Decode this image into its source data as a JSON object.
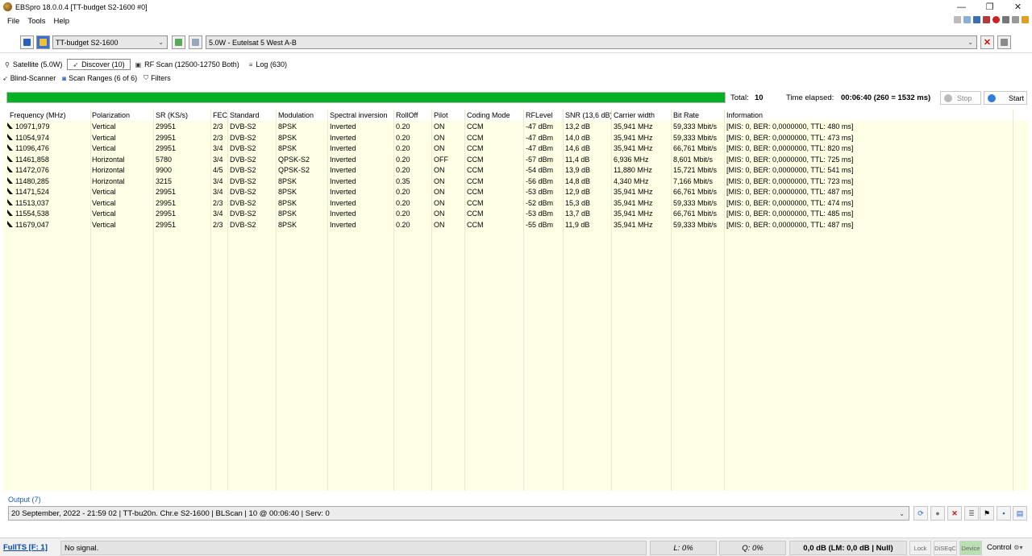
{
  "window": {
    "title": "EBSpro 18.0.0.4 [TT-budget S2-1600 #0]",
    "controls": {
      "minimize": "—",
      "restore": "❐",
      "close": "✕"
    }
  },
  "menu": [
    "File",
    "Tools",
    "Help"
  ],
  "device": {
    "selected": "TT-budget S2-1600",
    "satellite": "5.0W - Eutelsat 5 West A-B"
  },
  "tabs": [
    {
      "label": "Satellite (5.0W)",
      "icon": "satellite-icon"
    },
    {
      "label": "Discover (10)",
      "icon": "discover-icon"
    },
    {
      "label": "RF Scan (12500-12750 Both)",
      "icon": "rf-scan-icon"
    },
    {
      "label": "Log (630)",
      "icon": "log-icon"
    }
  ],
  "subtabs": [
    {
      "label": "Blind-Scanner",
      "icon": "blind-scanner-icon"
    },
    {
      "label": "Scan Ranges (6 of 6)",
      "icon": "scan-ranges-icon"
    },
    {
      "label": "Filters",
      "icon": "filter-icon"
    }
  ],
  "scan": {
    "progress": 1.0,
    "total_label": "Total:",
    "total_value": "10",
    "elapsed_label": "Time elapsed:",
    "elapsed_value": "00:06:40 (260 = 1532 ms)",
    "stop_label": "Stop",
    "start_label": "Start"
  },
  "table": {
    "columns": [
      "Frequency (MHz)",
      "Polarization",
      "SR (KS/s)",
      "FEC",
      "Standard",
      "Modulation",
      "Spectral inversion",
      "RollOff",
      "Pilot",
      "Coding Mode",
      "RFLevel",
      "SNR (13,6 dB)",
      "Carrier width",
      "Bit Rate",
      "Information"
    ],
    "rows": [
      [
        "10971,979",
        "Vertical",
        "29951",
        "2/3",
        "DVB-S2",
        "8PSK",
        "Inverted",
        "0.20",
        "ON",
        "CCM",
        "-47 dBm",
        "13,2 dB",
        "35,941 MHz",
        "59,333 Mbit/s",
        "[MIS: 0, BER: 0,0000000, TTL: 480 ms]"
      ],
      [
        "11054,974",
        "Vertical",
        "29951",
        "2/3",
        "DVB-S2",
        "8PSK",
        "Inverted",
        "0.20",
        "ON",
        "CCM",
        "-47 dBm",
        "14,0 dB",
        "35,941 MHz",
        "59,333 Mbit/s",
        "[MIS: 0, BER: 0,0000000, TTL: 473 ms]"
      ],
      [
        "11096,476",
        "Vertical",
        "29951",
        "3/4",
        "DVB-S2",
        "8PSK",
        "Inverted",
        "0.20",
        "ON",
        "CCM",
        "-47 dBm",
        "14,6 dB",
        "35,941 MHz",
        "66,761 Mbit/s",
        "[MIS: 0, BER: 0,0000000, TTL: 820 ms]"
      ],
      [
        "11461,858",
        "Horizontal",
        "5780",
        "3/4",
        "DVB-S2",
        "QPSK-S2",
        "Inverted",
        "0.20",
        "OFF",
        "CCM",
        "-57 dBm",
        "11,4 dB",
        "6,936 MHz",
        "8,601 Mbit/s",
        "[MIS: 0, BER: 0,0000000, TTL: 725 ms]"
      ],
      [
        "11472,076",
        "Horizontal",
        "9900",
        "4/5",
        "DVB-S2",
        "QPSK-S2",
        "Inverted",
        "0.20",
        "ON",
        "CCM",
        "-54 dBm",
        "13,9 dB",
        "11,880 MHz",
        "15,721 Mbit/s",
        "[MIS: 0, BER: 0,0000000, TTL: 541 ms]"
      ],
      [
        "11480,285",
        "Horizontal",
        "3215",
        "3/4",
        "DVB-S2",
        "8PSK",
        "Inverted",
        "0.35",
        "ON",
        "CCM",
        "-56 dBm",
        "14,8 dB",
        "4,340 MHz",
        "7,166 Mbit/s",
        "[MIS: 0, BER: 0,0000000, TTL: 723 ms]"
      ],
      [
        "11471,524",
        "Vertical",
        "29951",
        "3/4",
        "DVB-S2",
        "8PSK",
        "Inverted",
        "0.20",
        "ON",
        "CCM",
        "-53 dBm",
        "12,9 dB",
        "35,941 MHz",
        "66,761 Mbit/s",
        "[MIS: 0, BER: 0,0000000, TTL: 487 ms]"
      ],
      [
        "11513,037",
        "Vertical",
        "29951",
        "2/3",
        "DVB-S2",
        "8PSK",
        "Inverted",
        "0.20",
        "ON",
        "CCM",
        "-52 dBm",
        "15,3 dB",
        "35,941 MHz",
        "59,333 Mbit/s",
        "[MIS: 0, BER: 0,0000000, TTL: 474 ms]"
      ],
      [
        "11554,538",
        "Vertical",
        "29951",
        "3/4",
        "DVB-S2",
        "8PSK",
        "Inverted",
        "0.20",
        "ON",
        "CCM",
        "-53 dBm",
        "13,7 dB",
        "35,941 MHz",
        "66,761 Mbit/s",
        "[MIS: 0, BER: 0,0000000, TTL: 485 ms]"
      ],
      [
        "11679,047",
        "Vertical",
        "29951",
        "2/3",
        "DVB-S2",
        "8PSK",
        "Inverted",
        "0.20",
        "ON",
        "CCM",
        "-55 dBm",
        "11,9 dB",
        "35,941 MHz",
        "59,333 Mbit/s",
        "[MIS: 0, BER: 0,0000000, TTL: 487 ms]"
      ]
    ]
  },
  "output": {
    "label": "Output (7)",
    "selected": "20 September, 2022 - 21:59 02 | TT-bu20n. Chr.e S2-1600 | BLScan | 10 @ 00:06:40 | Serv: 0"
  },
  "status": {
    "link": "FullTS [F: 1]",
    "signal": "No signal.",
    "level": "L: 0%",
    "quality": "Q: 0%",
    "db": "0,0 dB (LM: 0,0 dB | Null)",
    "lock": "Lock",
    "diseqc": "DiSEqC",
    "device": "Device",
    "control": "Control"
  },
  "colors": {
    "grid_bg": "#ffffe6",
    "progress_fill": "#06b025",
    "output_label": "#1a5fb4",
    "device_indicator": "#b8e0b0"
  }
}
